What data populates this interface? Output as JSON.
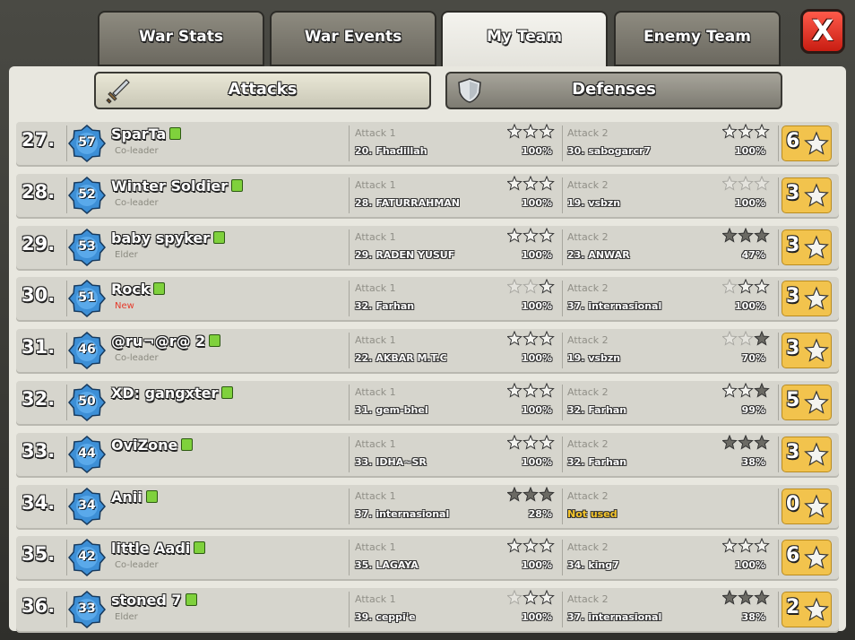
{
  "tabs": [
    {
      "label": "War Stats",
      "active": false
    },
    {
      "label": "War Events",
      "active": false
    },
    {
      "label": "My Team",
      "active": true
    },
    {
      "label": "Enemy Team",
      "active": false
    }
  ],
  "close_label": "X",
  "subtabs": {
    "attacks": "Attacks",
    "defenses": "Defenses"
  },
  "colors": {
    "star_filled": "#6b6a64",
    "star_empty": "#f4f4f0",
    "total_bg": "#f2c34d",
    "not_used": "#f5c52a",
    "new_role": "#e53a2a"
  },
  "rows": [
    {
      "rank": "27.",
      "level": "57",
      "name": "SparTa",
      "role": "Co-leader",
      "total": "6",
      "a1": {
        "label": "Attack 1",
        "target": "20. Fhadillah",
        "pct": "100%",
        "stars": [
          0,
          0,
          0
        ]
      },
      "a2": {
        "label": "Attack 2",
        "target": "30. sabogarcr7",
        "pct": "100%",
        "stars": [
          0,
          0,
          0
        ]
      }
    },
    {
      "rank": "28.",
      "level": "52",
      "name": "Winter Soldier",
      "role": "Co-leader",
      "total": "3",
      "a1": {
        "label": "Attack 1",
        "target": "28. FATURRAHMAN",
        "pct": "100%",
        "stars": [
          0,
          0,
          0
        ]
      },
      "a2": {
        "label": "Attack 2",
        "target": "19. vsbzn",
        "pct": "100%",
        "stars": [
          2,
          2,
          2
        ]
      }
    },
    {
      "rank": "29.",
      "level": "53",
      "name": "baby spyker",
      "role": "Elder",
      "total": "3",
      "a1": {
        "label": "Attack 1",
        "target": "29. RADEN YUSUF",
        "pct": "100%",
        "stars": [
          0,
          0,
          0
        ]
      },
      "a2": {
        "label": "Attack 2",
        "target": "23. ANWAR",
        "pct": "47%",
        "stars": [
          1,
          1,
          1
        ]
      }
    },
    {
      "rank": "30.",
      "level": "51",
      "name": "Rock",
      "role": "New",
      "total": "3",
      "a1": {
        "label": "Attack 1",
        "target": "32. Farhan",
        "pct": "100%",
        "stars": [
          2,
          2,
          0
        ]
      },
      "a2": {
        "label": "Attack 2",
        "target": "37. internasional",
        "pct": "100%",
        "stars": [
          2,
          0,
          0
        ]
      }
    },
    {
      "rank": "31.",
      "level": "46",
      "name": "@ru¬@r@ 2",
      "role": "Co-leader",
      "total": "3",
      "a1": {
        "label": "Attack 1",
        "target": "22. AKBAR M.T.C",
        "pct": "100%",
        "stars": [
          0,
          0,
          0
        ]
      },
      "a2": {
        "label": "Attack 2",
        "target": "19. vsbzn",
        "pct": "70%",
        "stars": [
          2,
          2,
          1
        ]
      }
    },
    {
      "rank": "32.",
      "level": "50",
      "name": "XD: gangxter",
      "role": "",
      "total": "5",
      "a1": {
        "label": "Attack 1",
        "target": "31. gem-bhel",
        "pct": "100%",
        "stars": [
          0,
          0,
          0
        ]
      },
      "a2": {
        "label": "Attack 2",
        "target": "32. Farhan",
        "pct": "99%",
        "stars": [
          0,
          0,
          1
        ]
      }
    },
    {
      "rank": "33.",
      "level": "44",
      "name": "OviZone",
      "role": "",
      "total": "3",
      "a1": {
        "label": "Attack 1",
        "target": "33. IDHA~SR",
        "pct": "100%",
        "stars": [
          0,
          0,
          0
        ]
      },
      "a2": {
        "label": "Attack 2",
        "target": "32. Farhan",
        "pct": "38%",
        "stars": [
          1,
          1,
          1
        ]
      }
    },
    {
      "rank": "34.",
      "level": "34",
      "name": "Anii",
      "role": "",
      "total": "0",
      "a1": {
        "label": "Attack 1",
        "target": "37. internasional",
        "pct": "28%",
        "stars": [
          1,
          1,
          1
        ]
      },
      "a2": {
        "label": "Attack 2",
        "target": "Not used",
        "pct": "",
        "stars": []
      }
    },
    {
      "rank": "35.",
      "level": "42",
      "name": "little Aadi",
      "role": "Co-leader",
      "total": "6",
      "a1": {
        "label": "Attack 1",
        "target": "35. LAGAYA",
        "pct": "100%",
        "stars": [
          0,
          0,
          0
        ]
      },
      "a2": {
        "label": "Attack 2",
        "target": "34. king7",
        "pct": "100%",
        "stars": [
          0,
          0,
          0
        ]
      }
    },
    {
      "rank": "36.",
      "level": "33",
      "name": "stoned 7",
      "role": "Elder",
      "total": "2",
      "a1": {
        "label": "Attack 1",
        "target": "39. ceppi'e",
        "pct": "100%",
        "stars": [
          2,
          0,
          0
        ]
      },
      "a2": {
        "label": "Attack 2",
        "target": "37. internasional",
        "pct": "38%",
        "stars": [
          1,
          1,
          1
        ]
      }
    }
  ]
}
